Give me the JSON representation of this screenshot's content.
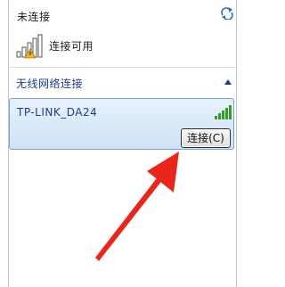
{
  "status": {
    "title": "未连接",
    "refresh_icon": "refresh-icon",
    "icon": "signal-bars-warning-icon",
    "connection_text": "连接可用"
  },
  "wireless_section": {
    "title": "无线网络连接",
    "collapse_icon": "chevron-up-icon",
    "networks": [
      {
        "ssid": "TP-LINK_DA24",
        "signal_icon": "signal-strength-icon",
        "connect_label": "连接(C)"
      }
    ]
  },
  "annotation": {
    "arrow_color": "#e8261c"
  },
  "colors": {
    "section_title": "#1f3c88",
    "selected_item_bg": "#d9e8f8",
    "signal_green": "#3a9a2a"
  }
}
